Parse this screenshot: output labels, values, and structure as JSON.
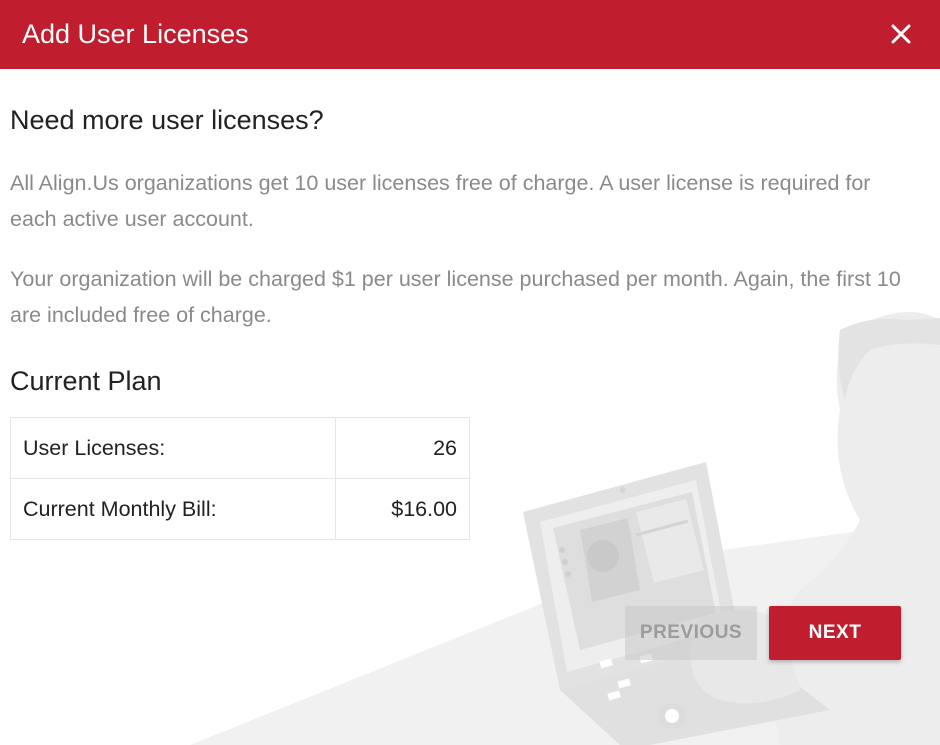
{
  "dialog": {
    "title": "Add User Licenses",
    "close_icon": "close-icon",
    "accent_color": "#c01d2e"
  },
  "intro": {
    "heading": "Need more user licenses?",
    "paragraph1": "All Align.Us organizations get 10 user licenses free of charge. A user license is required for each active user account.",
    "paragraph2": "Your organization will be charged $1 per user license purchased per month. Again, the first 10 are included free of charge."
  },
  "plan": {
    "heading": "Current Plan",
    "rows": [
      {
        "label": "User Licenses:",
        "value": "26"
      },
      {
        "label": "Current Monthly Bill:",
        "value": "$16.00"
      }
    ]
  },
  "buttons": {
    "previous": "PREVIOUS",
    "next": "NEXT"
  }
}
